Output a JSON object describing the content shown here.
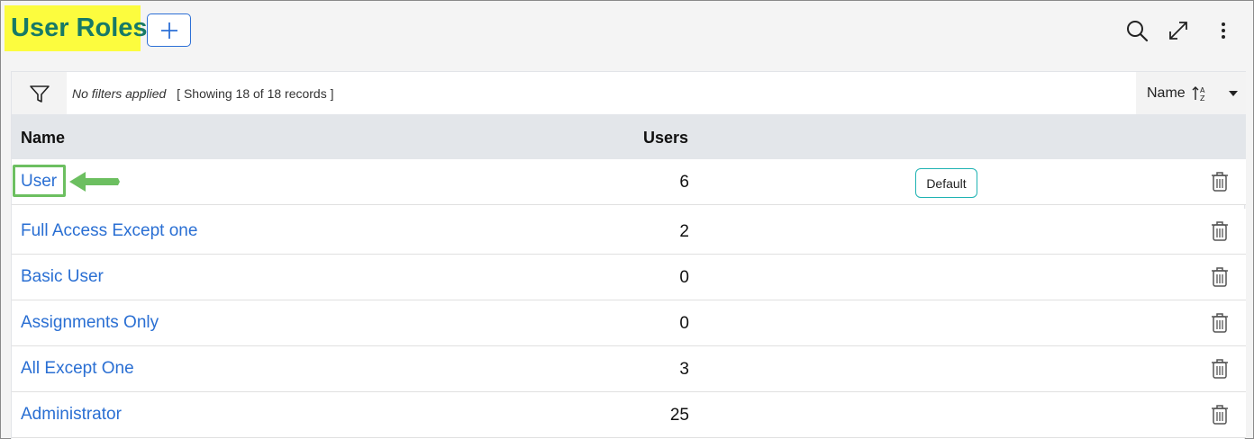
{
  "header": {
    "title": "User Roles",
    "add_icon": "plus-icon",
    "icons": [
      "search-icon",
      "expand-icon",
      "more-vertical-icon"
    ]
  },
  "filterbar": {
    "filter_icon": "filter-icon",
    "no_filters": "No filters applied",
    "showing": "[ Showing 18 of 18 records ]",
    "sort_label": "Name",
    "sort_icon": "sort-az-icon",
    "sort_caret": "caret-down-icon"
  },
  "table": {
    "columns": {
      "name": "Name",
      "users": "Users"
    },
    "default_badge": "Default",
    "rows": [
      {
        "name": "User",
        "users": "6"
      },
      {
        "name": "Full Access Except one",
        "users": "2"
      },
      {
        "name": "Basic User",
        "users": "0"
      },
      {
        "name": "Assignments Only",
        "users": "0"
      },
      {
        "name": "All Except One",
        "users": "3"
      },
      {
        "name": "Administrator",
        "users": "25"
      }
    ]
  },
  "colors": {
    "title": "#177a66",
    "title_highlight": "#fcfc3e",
    "link": "#2a6fd3",
    "annotation": "#6cbf60",
    "badge_border": "#1fb3b3"
  }
}
